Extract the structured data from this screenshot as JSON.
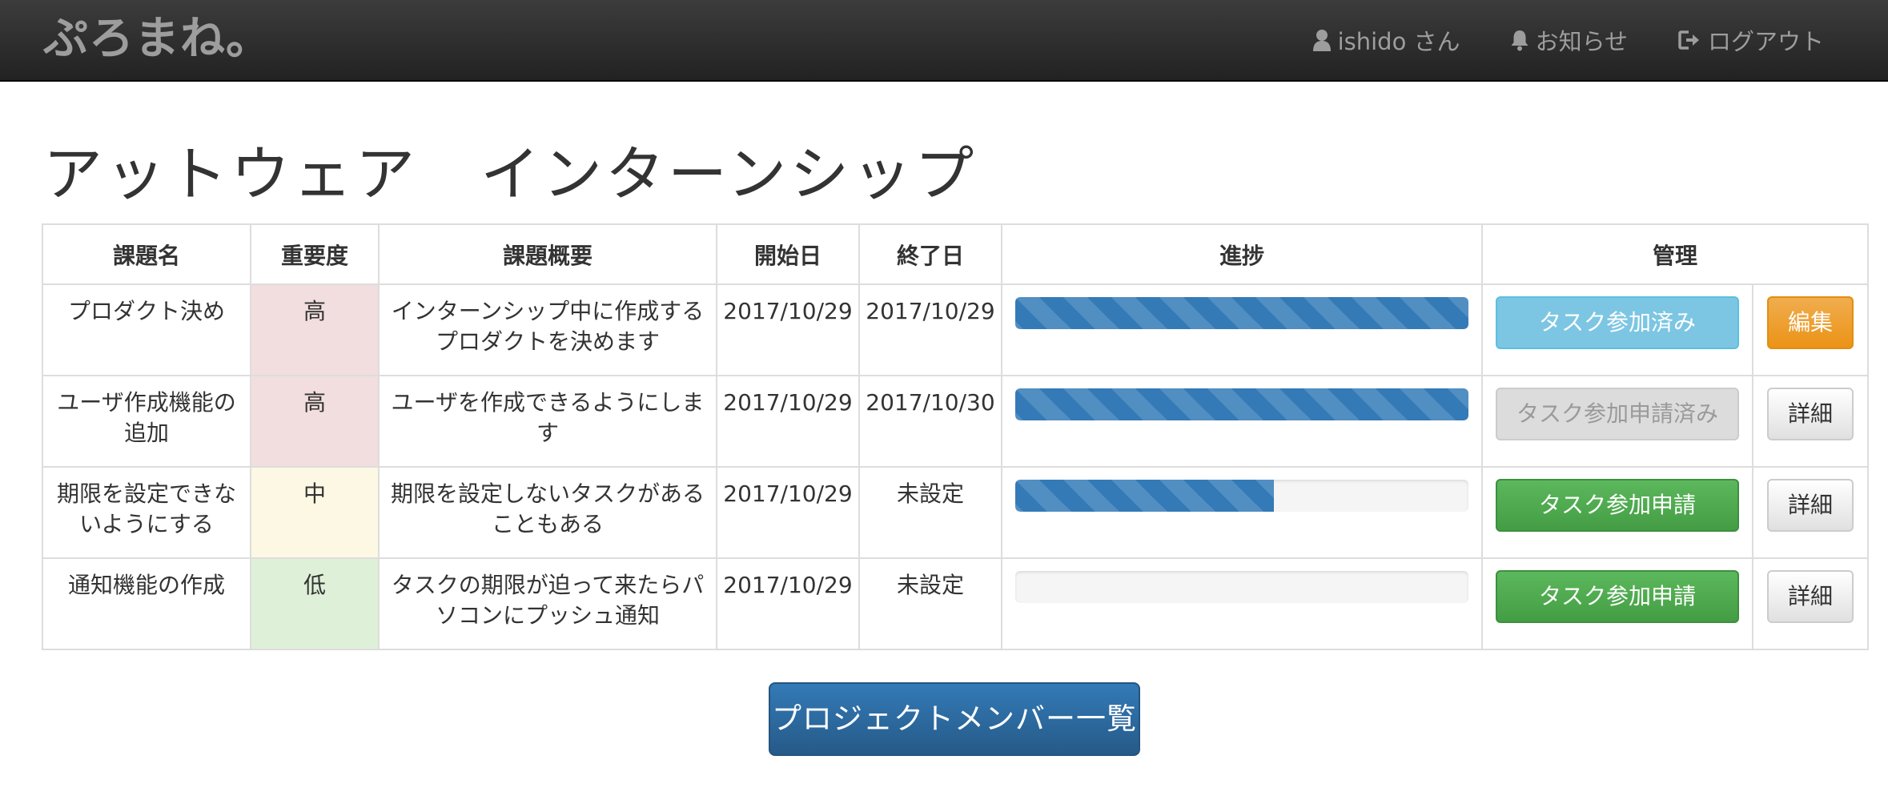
{
  "navbar": {
    "brand": "ぷろまね。",
    "user_label": "ishido さん",
    "notifications_label": "お知らせ",
    "logout_label": "ログアウト"
  },
  "page": {
    "title": "アットウェア　インターンシップ"
  },
  "table": {
    "headers": {
      "name": "課題名",
      "importance": "重要度",
      "summary": "課題概要",
      "start": "開始日",
      "end": "終了日",
      "progress": "進捗",
      "manage": "管理"
    },
    "rows": [
      {
        "name": "プロダクト決め",
        "importance": "高",
        "importance_color": "#f2dede",
        "summary": "インターンシップ中に作成するプロダクトを決めます",
        "start": "2017/10/29",
        "end": "2017/10/29",
        "progress_percent": 100,
        "task_button": "タスク参加済み",
        "action_button": "編集"
      },
      {
        "name": "ユーザ作成機能の追加",
        "importance": "高",
        "importance_color": "#f2dede",
        "summary": "ユーザを作成できるようにします",
        "start": "2017/10/29",
        "end": "2017/10/30",
        "progress_percent": 100,
        "task_button": "タスク参加申請済み",
        "action_button": "詳細"
      },
      {
        "name": "期限を設定できないようにする",
        "importance": "中",
        "importance_color": "#fcf8e3",
        "summary": "期限を設定しないタスクがあることもある",
        "start": "2017/10/29",
        "end": "未設定",
        "progress_percent": 57,
        "task_button": "タスク参加申請",
        "action_button": "詳細"
      },
      {
        "name": "通知機能の作成",
        "importance": "低",
        "importance_color": "#dff0d8",
        "summary": "タスクの期限が迫って来たらパソコンにプッシュ通知",
        "start": "2017/10/29",
        "end": "未設定",
        "progress_percent": 0,
        "task_button": "タスク参加申請",
        "action_button": "詳細"
      }
    ]
  },
  "footer": {
    "members_button": "プロジェクトメンバー一覧"
  },
  "icons": {
    "user": "user-icon",
    "notifications": "bell-icon",
    "logout": "logout-icon"
  },
  "colors": {
    "navbar_bg": "#222222",
    "primary": "#337ab7",
    "success": "#5cb85c",
    "info": "#5bc0de",
    "warning": "#f0ad4e"
  }
}
